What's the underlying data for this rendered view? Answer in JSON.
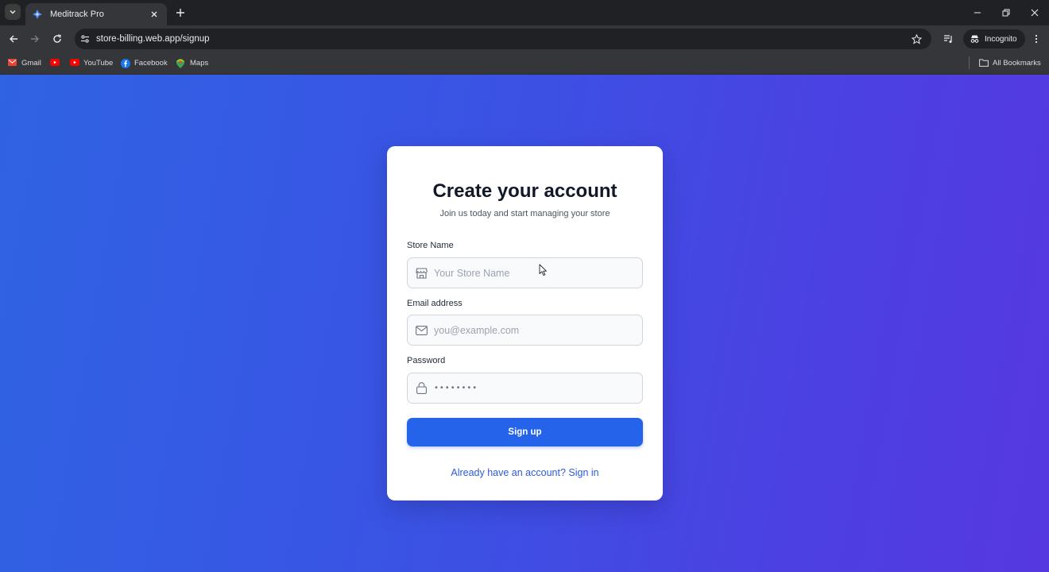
{
  "browser": {
    "tab_title": "Meditrack Pro",
    "url": "store-billing.web.app/signup",
    "incognito_label": "Incognito",
    "bookmarks": [
      {
        "label": "Gmail",
        "icon": "gmail-icon"
      },
      {
        "label": "",
        "icon": "youtube-icon"
      },
      {
        "label": "YouTube",
        "icon": "youtube-icon"
      },
      {
        "label": "Facebook",
        "icon": "facebook-icon"
      },
      {
        "label": "Maps",
        "icon": "maps-icon"
      }
    ],
    "all_bookmarks_label": "All Bookmarks"
  },
  "signup": {
    "title": "Create your account",
    "subtitle": "Join us today and start managing your store",
    "store_name": {
      "label": "Store Name",
      "placeholder": "Your Store Name",
      "value": "",
      "icon": "store-icon"
    },
    "email": {
      "label": "Email address",
      "placeholder": "you@example.com",
      "value": "",
      "icon": "mail-icon"
    },
    "password": {
      "label": "Password",
      "value": "••••••••",
      "icon": "lock-icon"
    },
    "submit_label": "Sign up",
    "signin_link": "Already have an account? Sign in"
  },
  "colors": {
    "primary": "#2563eb",
    "link": "#2d5bd7",
    "gradient_start": "#2f63e3",
    "gradient_end": "#5638e0"
  }
}
